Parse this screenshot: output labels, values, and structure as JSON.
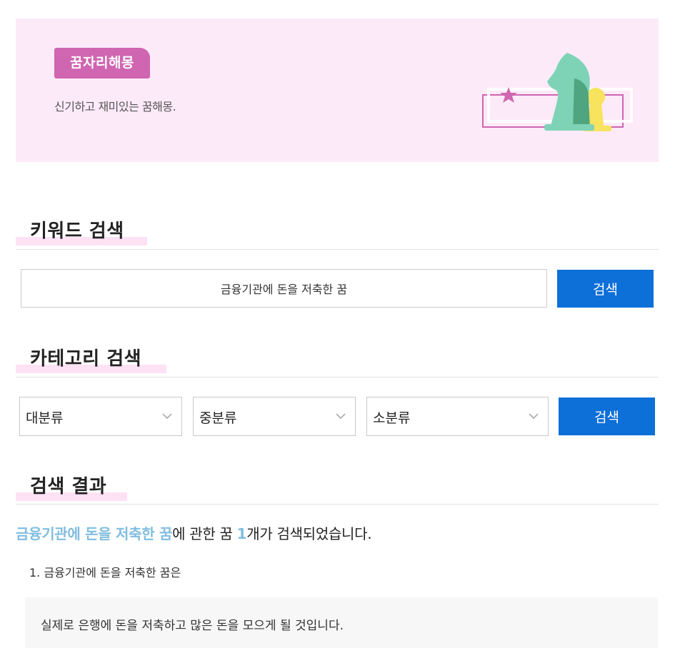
{
  "banner": {
    "badge": "꿈자리해몽",
    "description": "신기하고 재미있는 꿈해몽.",
    "illustration_icon": "chess-pieces-illustration"
  },
  "keyword_search": {
    "title": "키워드 검색",
    "input_value": "금융기관에 돈을 저축한 꿈",
    "button_label": "검색"
  },
  "category_search": {
    "title": "카테고리 검색",
    "selects": [
      {
        "label": "대분류"
      },
      {
        "label": "중분류"
      },
      {
        "label": "소분류"
      }
    ],
    "button_label": "검색"
  },
  "results": {
    "title": "검색 결과",
    "summary": {
      "keyword": "금융기관에 돈을 저축한 꿈",
      "middle": "에 관한 꿈 ",
      "count": "1",
      "suffix": "개가 검색되었습니다."
    },
    "items": [
      {
        "title": "1. 금융기관에 돈을 저축한 꿈은",
        "body": "실제로 은행에 돈을 저축하고 많은 돈을 모으게 될 것입니다."
      }
    ]
  },
  "colors": {
    "banner_bg": "#fdeaf8",
    "badge": "#d065b1",
    "button": "#0d6fd8",
    "highlight": "#80bde0"
  }
}
